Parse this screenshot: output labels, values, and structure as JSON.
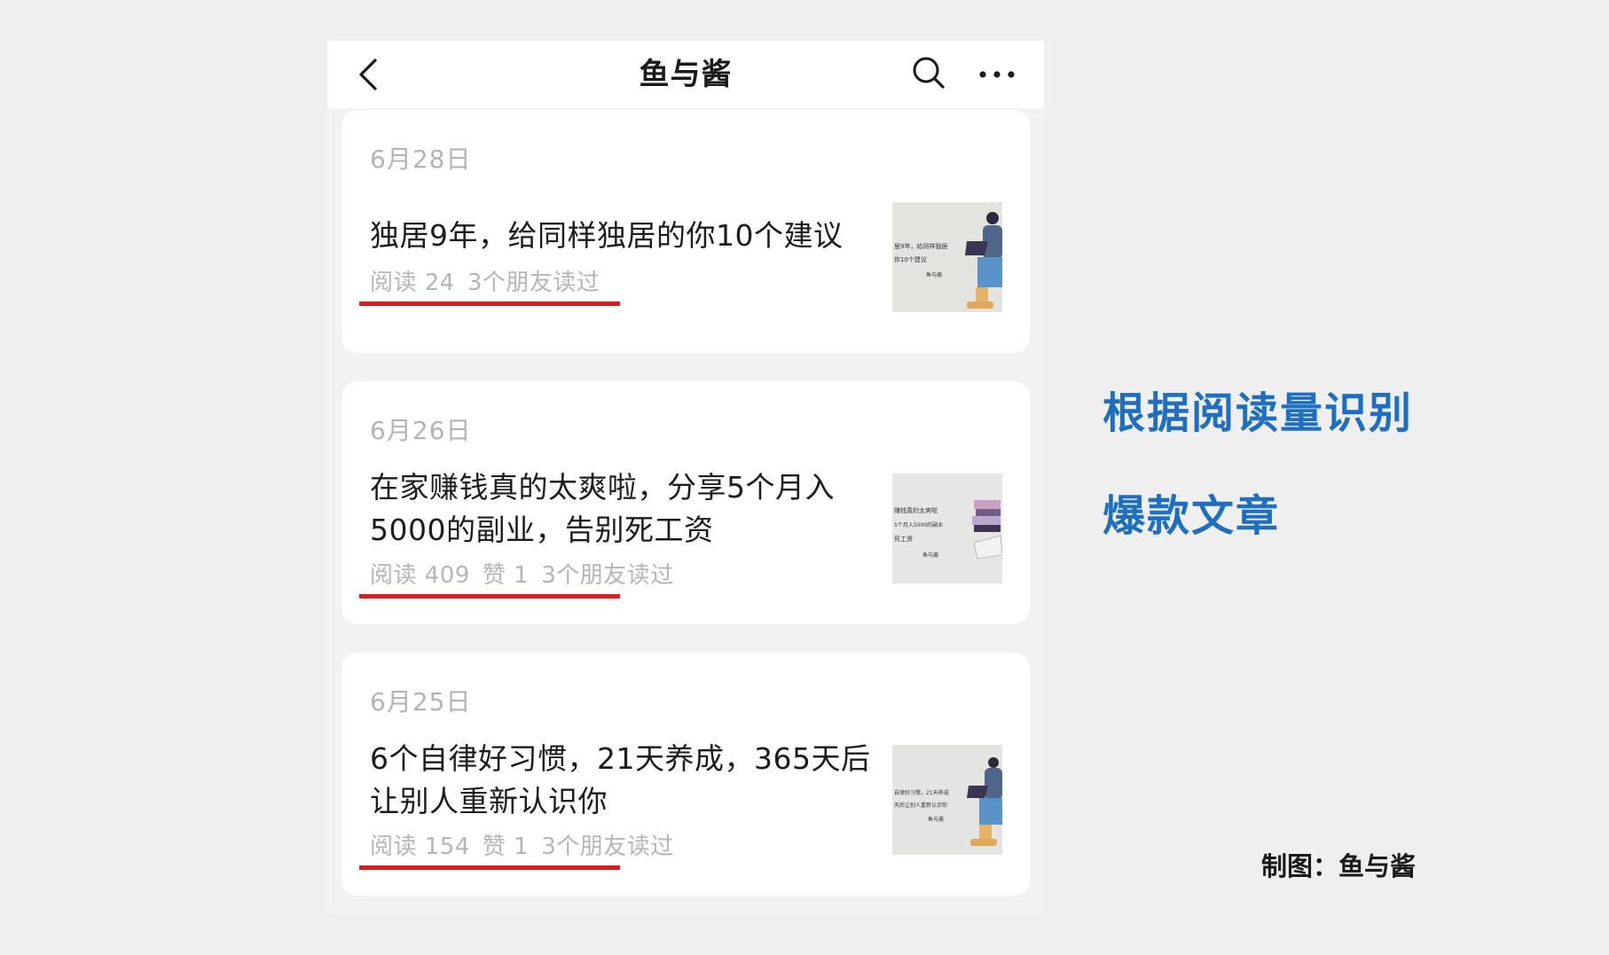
{
  "nav": {
    "title": "鱼与酱",
    "back_icon": "chevron-left-icon",
    "search_icon": "search-icon",
    "more_icon": "more-horizontal-icon"
  },
  "articles": [
    {
      "date": "6月28日",
      "title": "独居9年，给同样独居的你10个建议",
      "reads": "阅读 24",
      "likes": "",
      "friends": "3个朋友读过",
      "thumb_lines": [
        "居9年，给同样独居",
        "你10个建议",
        "鱼与酱"
      ]
    },
    {
      "date": "6月26日",
      "title": "在家赚钱真的太爽啦，分享5个月入5000的副业，告别死工资",
      "reads": "阅读 409",
      "likes": "赞 1",
      "friends": "3个朋友读过",
      "thumb_lines": [
        "赚钱真的太爽啦",
        "5个月入5000的副业",
        "死工资",
        "鱼与酱"
      ]
    },
    {
      "date": "6月25日",
      "title": "6个自律好习惯，21天养成，365天后让别人重新认识你",
      "reads": "阅读 154",
      "likes": "赞 1",
      "friends": "3个朋友读过",
      "thumb_lines": [
        "自律好习惯，21天养成",
        "天后让别人重新认识你",
        "鱼与酱"
      ]
    }
  ],
  "annotations": {
    "line1": "根据阅读量识别",
    "line2": "爆款文章",
    "credit": "制图：鱼与酱"
  },
  "colors": {
    "highlight": "#d81e1e",
    "annotation": "#1f6fc0"
  }
}
